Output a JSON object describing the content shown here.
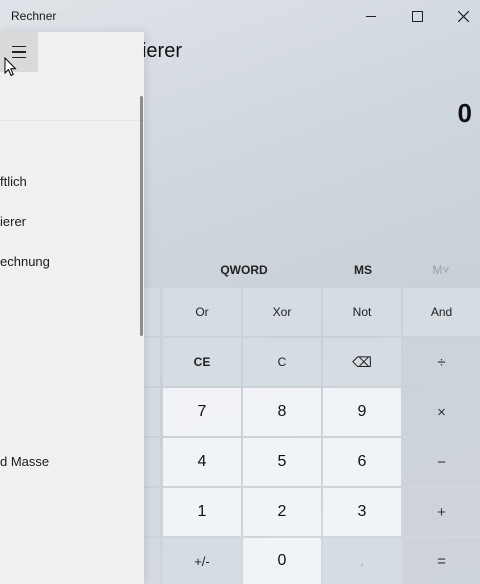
{
  "window": {
    "title": "Rechner",
    "controls": {
      "minimize": "minimize",
      "maximize": "maximize",
      "close": "close"
    }
  },
  "header": {
    "mode_title_visible": "ierer"
  },
  "display": {
    "value": "0"
  },
  "memory": {
    "word_size": "QWORD",
    "ms": "MS",
    "mv": "M˅"
  },
  "nav": {
    "items": [
      {
        "label": "ftlich"
      },
      {
        "label": "ierer"
      },
      {
        "label": "echnung"
      },
      {
        "label": "d Masse"
      }
    ]
  },
  "keys": {
    "row1": [
      "Or",
      "Xor",
      "Not",
      "And"
    ],
    "row2": [
      "CE",
      "C",
      "⌫",
      "÷"
    ],
    "row3": [
      "7",
      "8",
      "9",
      "×"
    ],
    "row4": [
      "4",
      "5",
      "6",
      "−"
    ],
    "row5": [
      "1",
      "2",
      "3",
      "+"
    ],
    "row6": [
      "+/-",
      "0",
      ",",
      "="
    ]
  },
  "colors": {
    "accent_bg": "#cfd6de",
    "nav_bg": "#f0f1f2",
    "number_key": "#f2f5f8"
  }
}
